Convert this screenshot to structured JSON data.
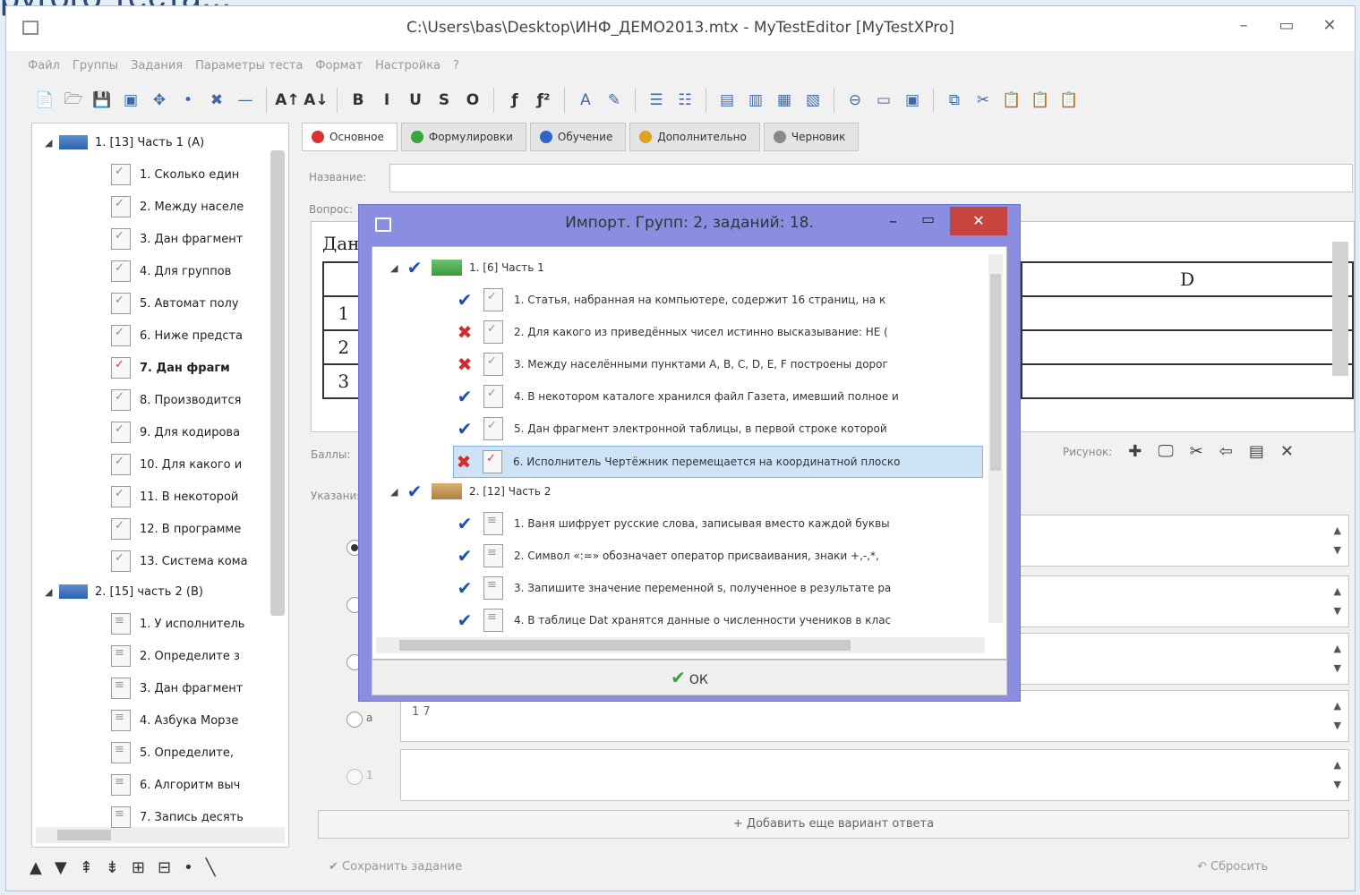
{
  "background_text": "ругого теста...",
  "window": {
    "title": "C:\\Users\\bas\\Desktop\\ИНФ_ДЕМО2013.mtx - MyTestEditor [MyTestXPro]",
    "min": "–",
    "max": "▭",
    "close": "✕"
  },
  "menu": [
    "Файл",
    "Группы",
    "Задания",
    "Параметры теста",
    "Формат",
    "Настройка",
    "?"
  ],
  "toolbar_icons": [
    "new-icon",
    "open-icon",
    "save-icon",
    "import-icon",
    "add-icon",
    "move-icon",
    "delete-icon",
    "minus-icon",
    "font-increase-icon",
    "font-decrease-icon",
    "bold-icon",
    "italic-icon",
    "underline-icon",
    "strike-icon",
    "outline-icon",
    "subscript-icon",
    "superscript-icon",
    "font-color-icon",
    "highlight-icon",
    "list-icon",
    "numbered-list-icon",
    "align-left-icon",
    "align-center-icon",
    "align-right-icon",
    "justify-icon",
    "circle-icon",
    "image-icon",
    "table-icon",
    "copy-icon",
    "cut-icon",
    "paste-icon",
    "paste2-icon",
    "paste3-icon"
  ],
  "toolbar_glyphs": [
    "📄",
    "🗁",
    "💾",
    "▣",
    "✥",
    "•",
    "✖",
    "—",
    "A↑",
    "A↓",
    "B",
    "I",
    "U",
    "S",
    "O",
    "ƒ",
    "ƒ²",
    "A",
    "✎",
    "☰",
    "☷",
    "▤",
    "▥",
    "▦",
    "▧",
    "⊖",
    "▭",
    "▣",
    "⧉",
    "✂",
    "📋",
    "📋",
    "📋"
  ],
  "tree": {
    "group1": "1. [13] Часть 1 (А)",
    "group1_items": [
      "1. Сколько един",
      "2. Между населе",
      "3. Дан фрагмент",
      "4. Для группов",
      "5. Автомат полу",
      "6. Ниже предста",
      "7. Дан фрагм",
      "8. Производится",
      "9. Для кодирова",
      "10. Для какого и",
      "11. В некоторой",
      "12. В программе",
      "13. Система кома"
    ],
    "group2": "2. [15] часть 2 (В)",
    "group2_items": [
      "1. У исполнитель",
      "2. Определите з",
      "3. Дан фрагмент",
      "4. Азбука Морзе",
      "5. Определите,",
      "6. Алгоритм выч",
      "7. Запись десять"
    ]
  },
  "bottom_tools": [
    "▲",
    "▼",
    "⇞",
    "⇟",
    "⊞",
    "⊟",
    "•",
    "╲"
  ],
  "tabs": [
    {
      "label": "Основное",
      "color": "#d63232"
    },
    {
      "label": "Формулировки",
      "color": "#3aa63a"
    },
    {
      "label": "Обучение",
      "color": "#2f64c8"
    },
    {
      "label": "Дополнительно",
      "color": "#e0a020"
    },
    {
      "label": "Черновик",
      "color": "#888888"
    }
  ],
  "fields": {
    "name_label": "Название:",
    "question_label": "Вопрос:",
    "question_start": "Дан",
    "table_header_d": "D",
    "row1": "1",
    "row2": "2",
    "row3": "3",
    "score_label": "Баллы:",
    "hint_label": "Указания:",
    "picture_label": "Рисунок:",
    "answer4_text": "1 7",
    "radio4_letter": "а",
    "radio5_letter": "1"
  },
  "picture_tools": [
    "✚",
    "🖵",
    "✂",
    "⇦",
    "▤",
    "✕"
  ],
  "add_answer": "+ Добавить еще вариант ответа",
  "save_task": "✔ Сохранить задание",
  "reset": "↶ Сбросить",
  "dialog": {
    "title": "Импорт. Групп: 2, заданий: 18.",
    "group1": "1. [6] Часть 1",
    "group1_items": [
      {
        "text": "1. Статья, набранная на компьютере, содержит 16 страниц, на к",
        "ok": true
      },
      {
        "text": "2. Для какого из приведённых чисел истинно высказывание: НЕ (",
        "ok": false
      },
      {
        "text": "3. Между населёнными пунктами A, B, C, D, E, F построены дорог",
        "ok": false
      },
      {
        "text": "4. В некотором каталоге хранился файл Газета, имевший полное и",
        "ok": true
      },
      {
        "text": "5. Дан фрагмент электронной таблицы, в первой строке которой",
        "ok": true
      },
      {
        "text": "6. Исполнитель Чертёжник перемещается на координатной плоско",
        "ok": false
      }
    ],
    "group2": "2. [12] Часть 2",
    "group2_items": [
      {
        "text": "1. Ваня шифрует русские слова, записывая вместо каждой буквы",
        "ok": true
      },
      {
        "text": "2. Символ «:=» обозначает оператор присваивания, знаки +,-,*,",
        "ok": true
      },
      {
        "text": "3. Запишите значение переменной s, полученное в результате ра",
        "ok": true
      },
      {
        "text": "4. В таблице Dat хранятся данные о численности учеников в клас",
        "ok": true
      }
    ],
    "ok_label": "ОК"
  }
}
